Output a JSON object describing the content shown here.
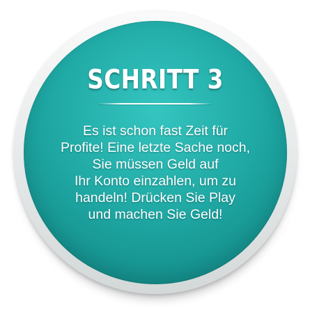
{
  "badge": {
    "title": "SCHRITT 3",
    "lines": [
      "Es ist schon fast Zeit für",
      "Profite! Eine letzte Sache noch,",
      "Sie müssen Geld auf",
      "Ihr Konto einzahlen, um zu",
      "handeln! Drücken Sie Play",
      "und machen Sie Geld!"
    ],
    "colors": {
      "disc": "#1fa8a4",
      "ring": "#e9ecec",
      "text": "#ffffff"
    }
  }
}
